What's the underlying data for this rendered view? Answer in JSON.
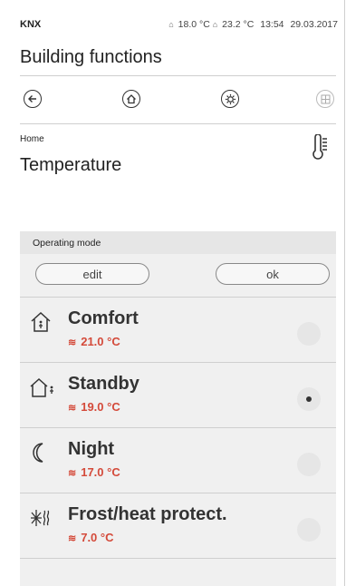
{
  "status": {
    "brand": "KNX",
    "outdoor_temp": "18.0 °C",
    "indoor_temp": "23.2 °C",
    "time": "13:54",
    "date": "29.03.2017"
  },
  "app_title": "Building functions",
  "breadcrumb": "Home",
  "page_title": "Temperature",
  "panel": {
    "title": "Operating mode",
    "edit_label": "edit",
    "ok_label": "ok"
  },
  "modes": [
    {
      "label": "Comfort",
      "temp": "21.0 °C",
      "icon": "house-person-icon",
      "selected": false
    },
    {
      "label": "Standby",
      "temp": "19.0 °C",
      "icon": "house-person-out-icon",
      "selected": true
    },
    {
      "label": "Night",
      "temp": "17.0 °C",
      "icon": "moon-icon",
      "selected": false
    },
    {
      "label": "Frost/heat protect.",
      "temp": "7.0 °C",
      "icon": "snow-heat-icon",
      "selected": false
    }
  ],
  "colors": {
    "temp_red": "#d44a3a",
    "panel_bg": "#f0f0f0"
  }
}
